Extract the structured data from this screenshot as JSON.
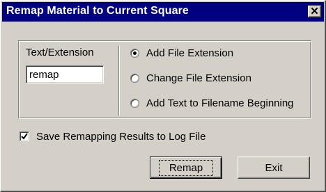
{
  "window": {
    "title": "Remap Material to Current Square",
    "close_label": "✕"
  },
  "group": {
    "text_extension_label": "Text/Extension",
    "text_extension_value": "remap",
    "options": [
      {
        "label": "Add File Extension",
        "selected": true
      },
      {
        "label": "Change File Extension",
        "selected": false
      },
      {
        "label": "Add Text to Filename Beginning",
        "selected": false
      }
    ]
  },
  "log_option": {
    "label": "Save Remapping Results to Log File",
    "checked": true
  },
  "buttons": {
    "remap_label": "Remap",
    "exit_label": "Exit"
  },
  "colors": {
    "titlebar": "#000080",
    "face": "#d4d0c8"
  }
}
